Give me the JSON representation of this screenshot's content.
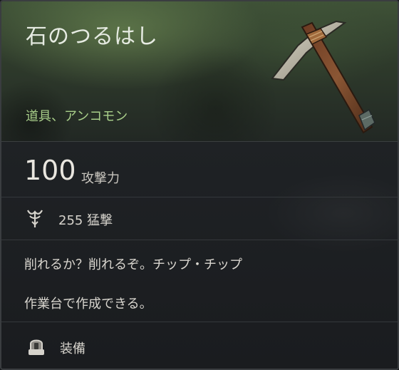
{
  "item": {
    "name": "石のつるはし",
    "category": "道具、アンコモン",
    "image_icon": "stone-pickaxe-icon"
  },
  "attack": {
    "value": "100",
    "label": "攻撃力"
  },
  "stat": {
    "icon": "ferocity-icon",
    "text": "255 猛撃"
  },
  "description": {
    "flavor": "削れるか？削れるぞ。チップ・チップ",
    "craft_info": "作業台で作成できる。"
  },
  "action": {
    "icon": "equip-icon",
    "label": "装備"
  },
  "colors": {
    "title": "#e6ebe2",
    "rarity": "#a9cf8a",
    "header_bg": "#3f5237",
    "body_bg": "#1c1f22"
  }
}
